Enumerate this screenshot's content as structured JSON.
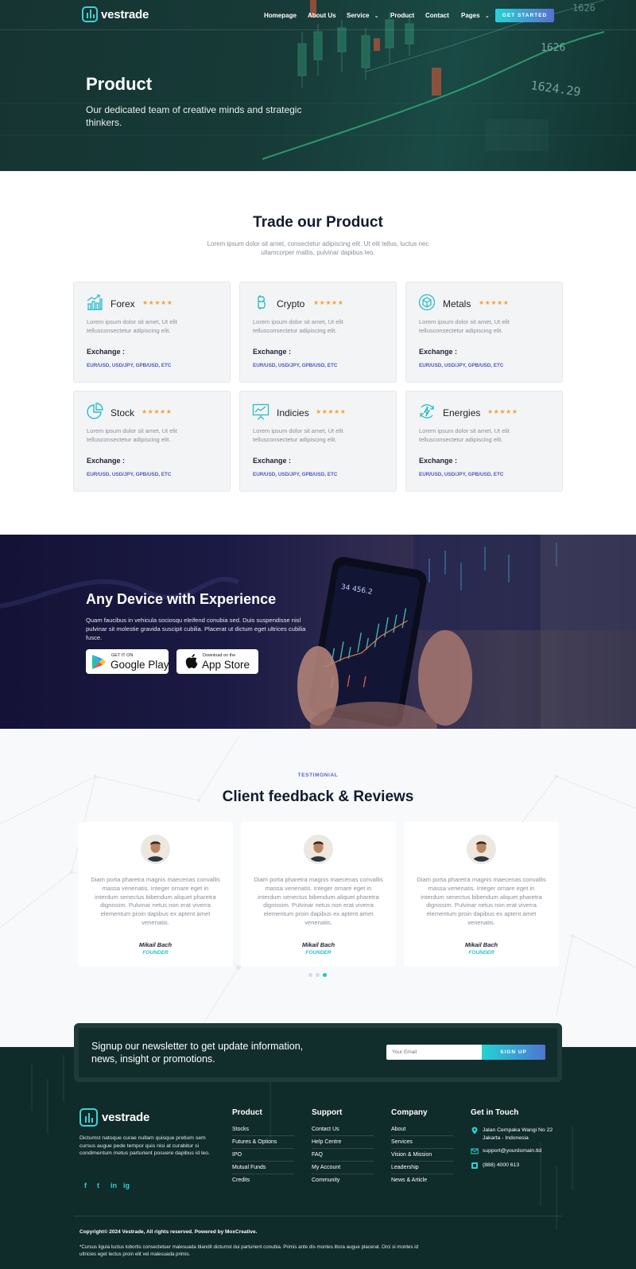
{
  "brand": {
    "name": "vestrade"
  },
  "nav": {
    "items": [
      "Homepage",
      "About Us",
      "Service",
      "Product",
      "Contact",
      "Pages"
    ],
    "cta": "GET STARTED"
  },
  "hero": {
    "title": "Product",
    "subtitle": "Our dedicated team of creative minds and strategic thinkers.",
    "ticker_1": "1626",
    "ticker_2": "1624.29",
    "ticker_3": "1626"
  },
  "products": {
    "title": "Trade our Product",
    "description": "Lorem ipsum dolor sit amet, consectetur adipiscing elit. Ut elit tellus, luctus nec ullamcorper mattis, pulvinar dapibus leo.",
    "items": [
      {
        "name": "Forex",
        "icon": "chart-bars-icon",
        "rating": 4.5,
        "stars": "★★★★★",
        "desc": "Lorem ipsum dolor sit amet, Ut elit tellusconsectetur adipiscing elit.",
        "label": "Exchange :",
        "values": "EUR/USD, USD/JPY, GPB/USD, ETC"
      },
      {
        "name": "Crypto",
        "icon": "bitcoin-icon",
        "rating": 4.5,
        "stars": "★★★★★",
        "desc": "Lorem ipsum dolor sit amet, Ut elit tellusconsectetur adipiscing elit.",
        "label": "Exchange :",
        "values": "EUR/USD, USD/JPY, GPB/USD, ETC"
      },
      {
        "name": "Metals",
        "icon": "metal-cube-icon",
        "rating": 4.5,
        "stars": "★★★★★",
        "desc": "Lorem ipsum dolor sit amet, Ut elit tellusconsectetur adipiscing elit.",
        "label": "Exchange :",
        "values": "EUR/USD, USD/JPY, GPB/USD, ETC"
      },
      {
        "name": "Stock",
        "icon": "pie-chart-icon",
        "rating": 4.5,
        "stars": "★★★★★",
        "desc": "Lorem ipsum dolor sit amet, Ut elit tellusconsectetur adipiscing elit.",
        "label": "Exchange :",
        "values": "EUR/USD, USD/JPY, GPB/USD, ETC"
      },
      {
        "name": "Indicies",
        "icon": "presentation-chart-icon",
        "rating": 4.5,
        "stars": "★★★★★",
        "desc": "Lorem ipsum dolor sit amet, Ut elit tellusconsectetur adipiscing elit.",
        "label": "Exchange :",
        "values": "EUR/USD, USD/JPY, GPB/USD, ETC"
      },
      {
        "name": "Energies",
        "icon": "energy-cycle-icon",
        "rating": 4.5,
        "stars": "★★★★★",
        "desc": "Lorem ipsum dolor sit amet, Ut elit tellusconsectetur adipiscing elit.",
        "label": "Exchange :",
        "values": "EUR/USD, USD/JPY, GPB/USD, ETC"
      }
    ]
  },
  "device": {
    "title": "Any Device with Experience",
    "text": "Quam faucibus in vehicula sociosqu eleifend conubia sed. Duis suspendisse nisl pulvinar sit molestie gravida suscipit cubilia. Placerat ut dictum eget ultrices cubilia fusce.",
    "screen_value": "34 456.2",
    "google": {
      "small": "GET IT ON",
      "big": "Google Play"
    },
    "apple": {
      "small": "Download on the",
      "big": "App Store"
    }
  },
  "testimonials": {
    "tag": "TESTIMONIAL",
    "title": "Client feedback & Reviews",
    "items": [
      {
        "quote": "Diam porta pharetra magnis maecenas convallis massa venenatis. Integer ornare eget in interdum senectus bibendum aliquet pharetra dignissim. Pulvinar netus non erat viverra elementum proin dapibus ex aptent amet venenatis.",
        "name": "Mikail Bach",
        "role": "FOUNDER"
      },
      {
        "quote": "Diam porta pharetra magnis maecenas convallis massa venenatis. Integer ornare eget in interdum senectus bibendum aliquet pharetra dignissim. Pulvinar netus non erat viverra elementum proin dapibus ex aptent amet venenatis.",
        "name": "Mikail Bach",
        "role": "FOUNDER"
      },
      {
        "quote": "Diam porta pharetra magnis maecenas convallis massa venenatis. Integer ornare eget in interdum senectus bibendum aliquet pharetra dignissim. Pulvinar netus non erat viverra elementum proin dapibus ex aptent amet venenatis.",
        "name": "Mikail Bach",
        "role": "FOUNDER"
      }
    ],
    "active_slide": 3,
    "slide_count": 3
  },
  "newsletter": {
    "text": "Signup our newsletter to get update information, news, insight or promotions.",
    "placeholder": "Your Email",
    "button": "SIGN UP"
  },
  "footer": {
    "about": "Dictumst natoque curae nullam quisque pretium sem cursus augue pede tempor quis nisi at curabitur si condimentum metus parturient posuere dapibus id leo.",
    "social": [
      "f",
      "t",
      "in",
      "ig"
    ],
    "columns": [
      {
        "title": "Product",
        "links": [
          "Stocks",
          "Futures & Options",
          "IPO",
          "Mutual Funds",
          "Credits"
        ]
      },
      {
        "title": "Support",
        "links": [
          "Contact Us",
          "Help Centre",
          "FAQ",
          "My Account",
          "Community"
        ]
      },
      {
        "title": "Company",
        "links": [
          "About",
          "Services",
          "Vision & Mission",
          "Leadership",
          "News & Article"
        ]
      }
    ],
    "contact": {
      "title": "Get in Touch",
      "address_1": "Jalan Cempaka Wangi No 22",
      "address_2": "Jakarta - Indonesia",
      "email": "support@yourdomain.tld",
      "phone": "(888) 4000 613"
    },
    "copyright": "Copyright© 2024 Vestrade, All rights reserved. Powered by MoxCreative.",
    "fine_print": "*Cursus ligula luctus lobortis consectetuer malesuada blandit dictumst dui parturient conubia. Primis ante dis montes litora augue placerat. Orci si montes id ultricies eget lectus proin elit vel malesuada primis."
  },
  "colors": {
    "accent_teal": "#27d2d6",
    "accent_indigo": "#5a63c9",
    "hero_bg": "#173b38",
    "star": "#f0a437",
    "footer_bg": "#0f2b2a"
  }
}
